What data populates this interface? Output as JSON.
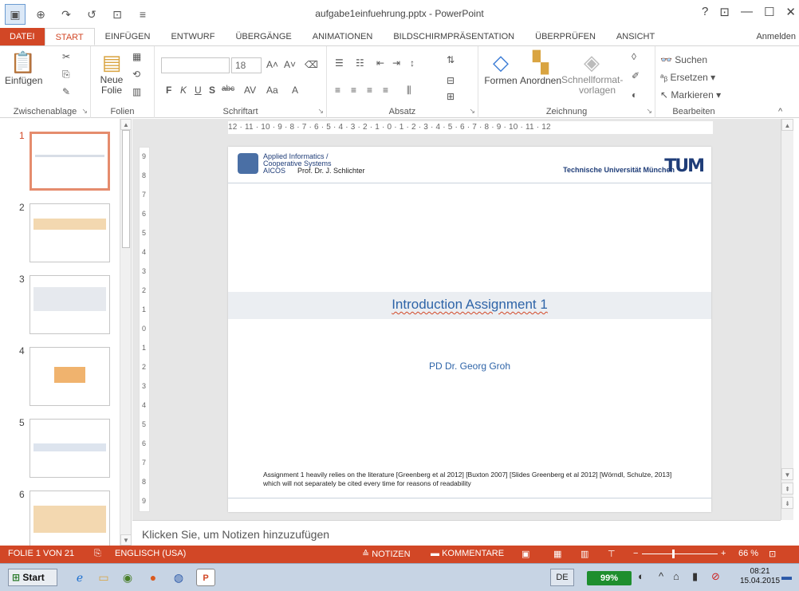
{
  "app": {
    "title": "aufgabe1einfuehrung.pptx - PowerPoint",
    "window_controls": [
      "?",
      "⊡",
      "—",
      "☐",
      "✕"
    ]
  },
  "quick_access": {
    "items": [
      "pointer-icon",
      "zoom-icon",
      "redo-icon",
      "repeat-icon",
      "preview-icon",
      "customize-icon"
    ]
  },
  "tabs": [
    {
      "label": "DATEI"
    },
    {
      "label": "START"
    },
    {
      "label": "EINFÜGEN"
    },
    {
      "label": "ENTWURF"
    },
    {
      "label": "ÜBERGÄNGE"
    },
    {
      "label": "ANIMATIONEN"
    },
    {
      "label": "BILDSCHIRMPRÄSENTATION"
    },
    {
      "label": "ÜBERPRÜFEN"
    },
    {
      "label": "ANSICHT"
    }
  ],
  "signin": "Anmelden",
  "ribbon": {
    "clipboard": {
      "label": "Zwischenablage",
      "paste": "Einfügen"
    },
    "slides": {
      "label": "Folien",
      "new_slide_1": "Neue",
      "new_slide_2": "Folie"
    },
    "font": {
      "label": "Schriftart",
      "size": "18",
      "bold": "F",
      "italic": "K",
      "underline": "U",
      "shadow": "S",
      "strike": "abc"
    },
    "paragraph": {
      "label": "Absatz"
    },
    "drawing": {
      "label": "Zeichnung",
      "shapes": "Formen",
      "arrange": "Anordnen",
      "quickstyles_1": "Schnellformat-",
      "quickstyles_2": "vorlagen"
    },
    "editing": {
      "label": "Bearbeiten",
      "find": "Suchen",
      "replace": "Ersetzen",
      "select": "Markieren"
    }
  },
  "thumbnails": [
    {
      "num": "1"
    },
    {
      "num": "2"
    },
    {
      "num": "3"
    },
    {
      "num": "4"
    },
    {
      "num": "5"
    },
    {
      "num": "6"
    }
  ],
  "ruler": {
    "horizontal": "12 · 11 · 10 · 9 · 8 · 7 · 6 · 5 · 4 · 3 · 2 · 1 · 0 · 1 · 2 · 3 · 4 · 5 · 6 · 7 · 8 · 9 · 10 · 11 · 12",
    "vertical": [
      "9",
      "8",
      "7",
      "6",
      "5",
      "4",
      "3",
      "2",
      "1",
      "0",
      "1",
      "2",
      "3",
      "4",
      "5",
      "6",
      "7",
      "8",
      "9"
    ]
  },
  "slide": {
    "institute_1": "Applied Informatics /",
    "institute_2": "Cooperative Systems",
    "institute_3": "AICOS",
    "professor": "Prof. Dr. J. Schlichter",
    "university": "Technische Universität München",
    "tum_logo": "TUM",
    "title": "Introduction Assignment 1",
    "author": "PD Dr. Georg Groh",
    "footer": "Assignment 1 heavily relies on the literature [Greenberg et al 2012] [Buxton 2007] [Slides Greenberg et al 2012] [Wörndl, Schulze, 2013] which will not separately be cited every time for reasons of readability"
  },
  "notes_placeholder": "Klicken Sie, um Notizen hinzuzufügen",
  "status": {
    "slide_count": "FOLIE 1 VON 21",
    "language": "ENGLISCH (USA)",
    "notes": "NOTIZEN",
    "comments": "KOMMENTARE",
    "zoom": "66 %",
    "zoom_level": 0.66
  },
  "taskbar": {
    "start": "Start",
    "lang": "DE",
    "battery": "99%",
    "time": "08:21",
    "date": "15.04.2015"
  },
  "colors": {
    "accent": "#d24726",
    "slide_title": "#2e64a8"
  }
}
